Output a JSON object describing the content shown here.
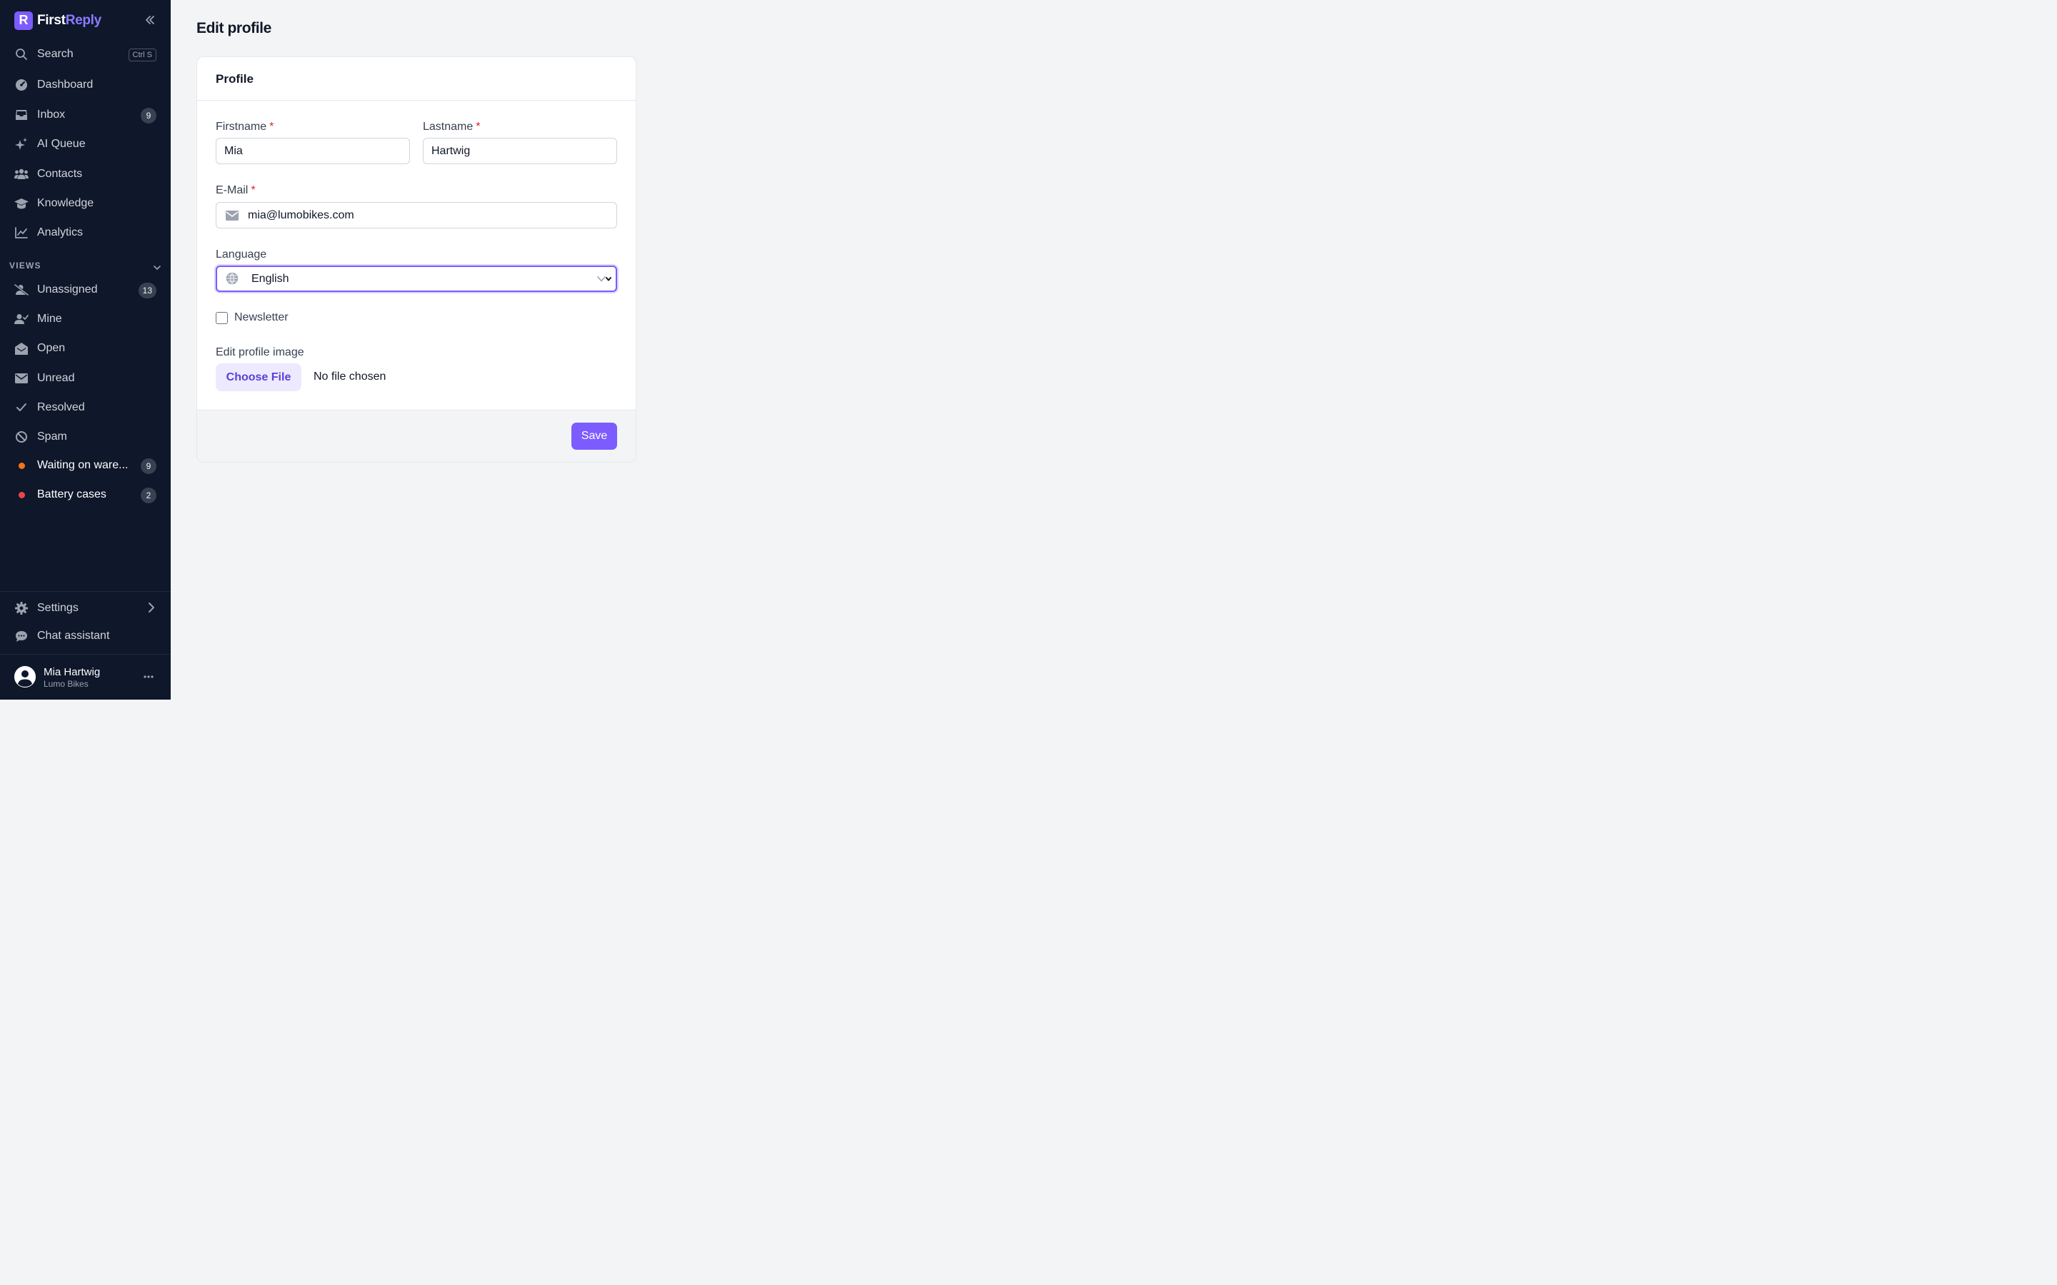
{
  "brand": {
    "first": "First",
    "reply": "Reply",
    "logo_letter": "R",
    "accent": "#7c5cff"
  },
  "sidebar": {
    "search": {
      "label": "Search",
      "shortcut": "Ctrl S"
    },
    "nav": [
      {
        "label": "Dashboard",
        "icon": "dashboard-icon"
      },
      {
        "label": "Inbox",
        "icon": "inbox-icon",
        "badge": "9"
      },
      {
        "label": "AI Queue",
        "icon": "sparkles-icon"
      },
      {
        "label": "Contacts",
        "icon": "users-icon"
      },
      {
        "label": "Knowledge",
        "icon": "graduation-cap-icon"
      },
      {
        "label": "Analytics",
        "icon": "chart-line-icon"
      }
    ],
    "views_title": "VIEWS",
    "views": [
      {
        "label": "Unassigned",
        "icon": "user-slash-icon",
        "badge": "13"
      },
      {
        "label": "Mine",
        "icon": "user-check-icon"
      },
      {
        "label": "Open",
        "icon": "envelope-open-icon"
      },
      {
        "label": "Unread",
        "icon": "envelope-icon"
      },
      {
        "label": "Resolved",
        "icon": "check-icon"
      },
      {
        "label": "Spam",
        "icon": "ban-icon"
      },
      {
        "label": "Waiting on ware...",
        "dot_color": "#f97316",
        "badge": "9"
      },
      {
        "label": "Battery cases",
        "dot_color": "#ef4444",
        "badge": "2"
      }
    ],
    "settings": "Settings",
    "chat_assistant": "Chat assistant",
    "user": {
      "name": "Mia Hartwig",
      "org": "Lumo Bikes"
    }
  },
  "page": {
    "title": "Edit profile",
    "card_title": "Profile",
    "form": {
      "firstname_label": "Firstname",
      "firstname_value": "Mia",
      "lastname_label": "Lastname",
      "lastname_value": "Hartwig",
      "email_label": "E-Mail",
      "email_value": "mia@lumobikes.com",
      "language_label": "Language",
      "language_value": "English",
      "newsletter_label": "Newsletter",
      "newsletter_checked": false,
      "image_label": "Edit profile image",
      "choose_file": "Choose File",
      "file_status": "No file chosen",
      "required_mark": "*"
    },
    "save_label": "Save"
  }
}
